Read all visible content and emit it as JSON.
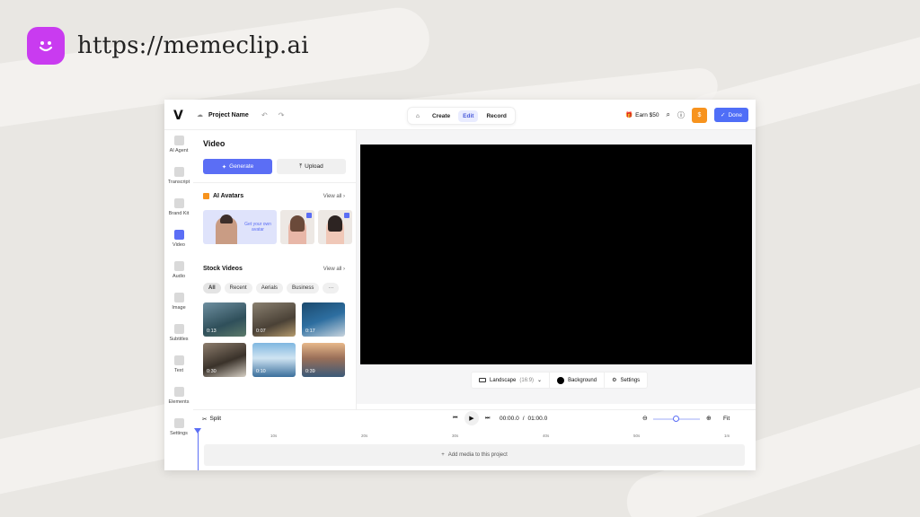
{
  "brand": {
    "url": "https://memeclip.ai",
    "logo_icon": "smiley-face-icon",
    "color": "#c93bf0"
  },
  "topbar": {
    "project_name": "Project Name",
    "tabs": [
      "Create",
      "Edit",
      "Record"
    ],
    "active_tab": "Edit",
    "earn": "Earn $50",
    "done": "Done"
  },
  "rail": [
    {
      "label": "AI Agent"
    },
    {
      "label": "Transcript"
    },
    {
      "label": "Brand Kit"
    },
    {
      "label": "Video"
    },
    {
      "label": "Audio"
    },
    {
      "label": "Image"
    },
    {
      "label": "Subtitles"
    },
    {
      "label": "Text"
    },
    {
      "label": "Elements"
    },
    {
      "label": "Settings"
    }
  ],
  "rail_active": "Video",
  "panel": {
    "title": "Video",
    "generate": "Generate",
    "upload": "Upload",
    "avatars": {
      "title": "AI Avatars",
      "view_all": "View all",
      "cta": "Get your own avatar"
    },
    "stock": {
      "title": "Stock Videos",
      "view_all": "View all",
      "chips": [
        "All",
        "Recent",
        "Aerials",
        "Business",
        "···"
      ],
      "thumbs": [
        {
          "duration": "0:13"
        },
        {
          "duration": "0:07"
        },
        {
          "duration": "0:17"
        },
        {
          "duration": "0:30"
        },
        {
          "duration": "0:10"
        },
        {
          "duration": "0:39"
        }
      ]
    }
  },
  "canvas": {
    "aspect": "Landscape",
    "aspect_ratio": "(16:9)",
    "background": "Background",
    "settings": "Settings"
  },
  "timeline": {
    "split": "Split",
    "current": "00:00.0",
    "separator": "/",
    "total": "01:00.0",
    "fit": "Fit",
    "ticks": [
      "10s",
      "20s",
      "30s",
      "40s",
      "50s",
      "1m"
    ],
    "add_media": "Add media to this project"
  },
  "colors": {
    "accent": "#5b6ef5",
    "orange": "#f7931e"
  }
}
